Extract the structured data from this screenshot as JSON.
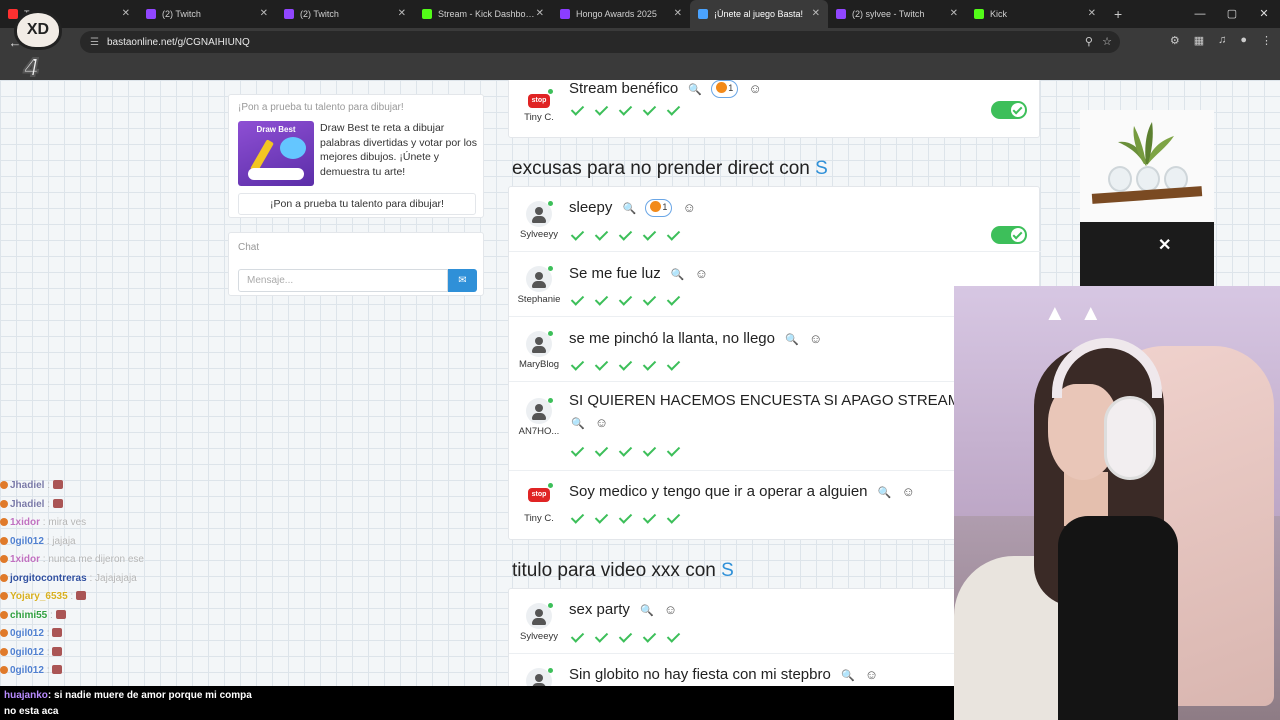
{
  "browser": {
    "tabs": [
      {
        "label": "Tube",
        "color": "#ff3030",
        "active": false
      },
      {
        "label": "(2) Twitch",
        "color": "#9146ff",
        "active": false
      },
      {
        "label": "(2) Twitch",
        "color": "#9146ff",
        "active": false
      },
      {
        "label": "Stream - Kick Dashboard",
        "color": "#53fc18",
        "active": false
      },
      {
        "label": "Hongo Awards 2025",
        "color": "#8b3dff",
        "active": false
      },
      {
        "label": "¡Únete al juego Basta!",
        "color": "#4aa3ff",
        "active": true
      },
      {
        "label": "(2) sylvee - Twitch",
        "color": "#9146ff",
        "active": false
      },
      {
        "label": "Kick",
        "color": "#53fc18",
        "active": false
      }
    ],
    "url": "bastaonline.net/g/CGNAIHIUNQ"
  },
  "overlay": {
    "logo_text": "XD",
    "logo_number": "4"
  },
  "sidebar": {
    "promo_title": "¡Pon a prueba tu talento para dibujar!",
    "promo_image_title": "Draw Best",
    "promo_description": "Draw Best te reta a dibujar palabras divertidas y votar por los mejores dibujos. ¡Únete y demuestra tu arte!",
    "promo_button": "¡Pon a prueba tu talento para dibujar!",
    "chat_title": "Chat",
    "chat_placeholder": "Mensaje..."
  },
  "top_row": {
    "user": "Tiny C.",
    "answer": "Stream benéfico",
    "votes": "1"
  },
  "categories": [
    {
      "title": "excusas para no prender direct con",
      "letter": "S",
      "rows": [
        {
          "user": "Sylveeyy",
          "answer": "sleepy",
          "votes": "1"
        },
        {
          "user": "Stephanie",
          "answer": "Se me fue luz"
        },
        {
          "user": "MaryBlog",
          "answer": "se me pinchó la llanta, no llego"
        },
        {
          "user": "AN7HO...",
          "answer": "SI QUIEREN HACEMOS ENCUESTA SI APAGO STREAM"
        },
        {
          "user": "Tiny C.",
          "answer": "Soy medico y tengo que ir a operar a alguien"
        }
      ]
    },
    {
      "title": "titulo para video xxx con",
      "letter": "S",
      "rows": [
        {
          "user": "Sylveeyy",
          "answer": "sex party"
        },
        {
          "user": "",
          "answer": "Sin globito no hay fiesta con mi stepbro"
        }
      ]
    }
  ],
  "icons": {
    "magnifier": "🔍",
    "smiley": "☺",
    "stop_sign": "stop",
    "send": "✉",
    "close": "✕"
  },
  "stream_chat": [
    {
      "user": "Jhadiel",
      "msg": ""
    },
    {
      "user": "Jhadiel",
      "msg": ""
    },
    {
      "user": "1xidor",
      "msg": "mira ves"
    },
    {
      "user": "0gil012",
      "msg": "jajaja"
    },
    {
      "user": "1xidor",
      "msg": "nunca me dijeron ese"
    },
    {
      "user": "jorgitocontreras",
      "msg": "Jajajajaja"
    },
    {
      "user": "Yojary_6535",
      "msg": ""
    },
    {
      "user": "chimi55",
      "msg": ""
    },
    {
      "user": "0gil012",
      "msg": ""
    },
    {
      "user": "0gil012",
      "msg": ""
    },
    {
      "user": "0gil012",
      "msg": ""
    }
  ],
  "caption": {
    "user": "huajanko",
    "line1": ": si nadie muere de amor porque mi compa",
    "line2": "no esta aca"
  },
  "colors": {
    "accent": "#2f90d8",
    "check": "#3dbf5a",
    "stop": "#e02424"
  }
}
